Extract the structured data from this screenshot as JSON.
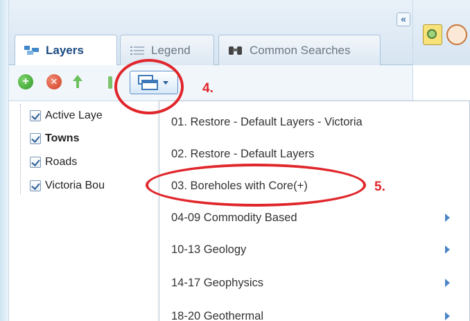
{
  "panel": {
    "collapse_button": "«",
    "tabs": [
      {
        "label": "Layers",
        "icon": "layers-icon",
        "active": true
      },
      {
        "label": "Legend",
        "icon": "legend-list-icon",
        "active": false
      },
      {
        "label": "Common Searches",
        "icon": "binoculars-icon",
        "active": false
      }
    ]
  },
  "toolbar": {
    "add_icon": "+",
    "remove_icon": "✕"
  },
  "tree": {
    "items": [
      {
        "label": "Active Laye",
        "checked": true,
        "bold": false
      },
      {
        "label": "Towns",
        "checked": true,
        "bold": true
      },
      {
        "label": "Roads",
        "checked": true,
        "bold": false
      },
      {
        "label": "Victoria Bou",
        "checked": true,
        "bold": false
      }
    ]
  },
  "menu": {
    "items": [
      {
        "label": "01. Restore - Default Layers - Victoria",
        "submenu": false
      },
      {
        "label": "02. Restore - Default Layers",
        "submenu": false
      },
      {
        "label": "03. Boreholes with Core(+)",
        "submenu": false
      },
      {
        "label": "04-09 Commodity Based",
        "submenu": true
      },
      {
        "label": "10-13 Geology",
        "submenu": true
      },
      {
        "label": "14-17 Geophysics",
        "submenu": true
      },
      {
        "label": "18-20 Geothermal",
        "submenu": true
      }
    ]
  },
  "annotations": {
    "step4": "4.",
    "step5": "5."
  },
  "colors": {
    "annotation_red": "#e0262b",
    "accent_blue": "#1a4a80",
    "submenu_arrow": "#4d86c6"
  }
}
